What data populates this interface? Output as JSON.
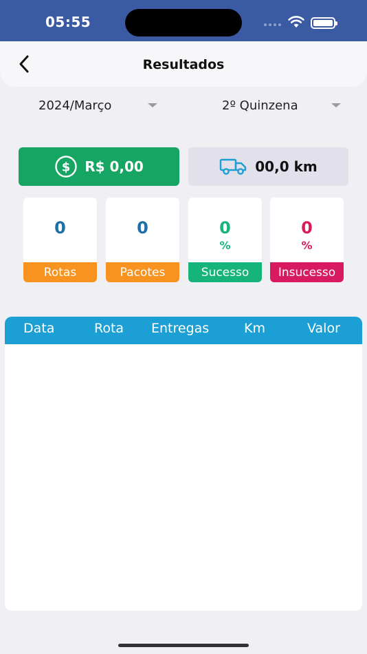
{
  "status_bar": {
    "time": "05:55"
  },
  "header": {
    "title": "Resultados"
  },
  "filters": {
    "period": "2024/Março",
    "fortnight": "2º Quinzena"
  },
  "summary": {
    "earnings": "R$ 0,00",
    "distance": "00,0 km"
  },
  "stats": [
    {
      "value": "0",
      "unit": "",
      "label": "Rotas",
      "value_color": "#1d6fa8",
      "label_color": "#f7931e"
    },
    {
      "value": "0",
      "unit": "",
      "label": "Pacotes",
      "value_color": "#1d6fa8",
      "label_color": "#f7931e"
    },
    {
      "value": "0",
      "unit": "%",
      "label": "Sucesso",
      "value_color": "#16b37a",
      "label_color": "#16b37a"
    },
    {
      "value": "0",
      "unit": "%",
      "label": "Insucesso",
      "value_color": "#d81b60",
      "label_color": "#d81b60"
    }
  ],
  "table": {
    "columns": [
      "Data",
      "Rota",
      "Entregas",
      "Km",
      "Valor"
    ],
    "rows": []
  },
  "colors": {
    "status_bar": "#3a5aa3",
    "money_card": "#16a563",
    "km_card": "#e2e0ea",
    "table_header": "#1b9fd5",
    "truck_icon": "#1b9fd5"
  }
}
